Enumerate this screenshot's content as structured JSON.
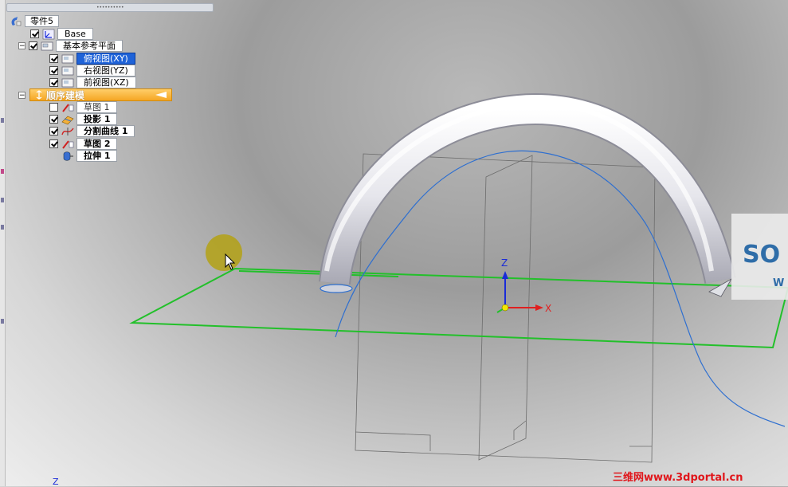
{
  "tree": {
    "root": {
      "label": "零件5"
    },
    "base": {
      "label": "Base",
      "checked": true
    },
    "refplanes": {
      "label": "基本参考平面",
      "checked": true,
      "expander": "−"
    },
    "planes": [
      {
        "label": "俯视图(XY)",
        "checked": true,
        "selected": true
      },
      {
        "label": "右视图(YZ)",
        "checked": true,
        "selected": false
      },
      {
        "label": "前视图(XZ)",
        "checked": true,
        "selected": false
      }
    ],
    "ordered": {
      "label": "顺序建模",
      "expander": "−"
    },
    "features": [
      {
        "label": "草图 1",
        "checked": false,
        "icon": "sketch-icon"
      },
      {
        "label": "投影 1",
        "checked": true,
        "icon": "projection-icon"
      },
      {
        "label": "分割曲线 1",
        "checked": true,
        "icon": "split-curve-icon"
      },
      {
        "label": "草图 2",
        "checked": true,
        "icon": "sketch-icon"
      },
      {
        "label": "拉伸 1",
        "checked": null,
        "icon": "extrude-icon"
      }
    ]
  },
  "triad": {
    "z": "Z",
    "x": "X"
  },
  "watermark": {
    "logo_text": "SO",
    "sub_text": "W"
  },
  "footer_watermark": "三维网www.3dportal.cn",
  "corner_axis": "Z",
  "colors": {
    "selection": "#1f63d8",
    "ordered_bar": "#f5a623",
    "plane_edge": "#22c02a",
    "curve": "#2e6fd0",
    "axis_x": "#e02020",
    "axis_z": "#1a2bd8",
    "footer": "#e0161b"
  }
}
